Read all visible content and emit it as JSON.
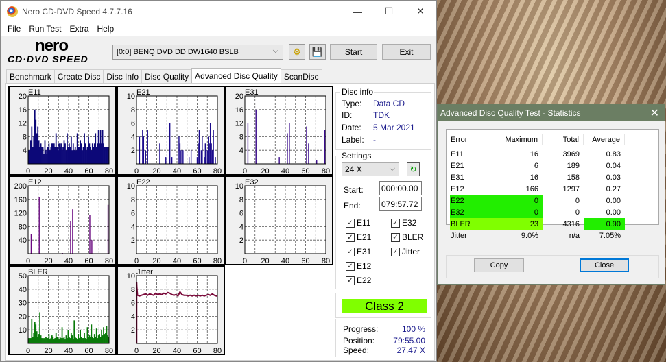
{
  "window": {
    "title": "Nero CD-DVD Speed 4.7.7.16",
    "controls": {
      "minimize": "—",
      "maximize": "☐",
      "close": "✕"
    }
  },
  "menu": [
    "File",
    "Run Test",
    "Extra",
    "Help"
  ],
  "logo": {
    "brand": "nero",
    "product": "CD·DVD SPEED"
  },
  "toolbar": {
    "drive": "[0:0]  BENQ DVD DD DW1640 BSLB",
    "start_label": "Start",
    "exit_label": "Exit"
  },
  "tabs": [
    {
      "label": "Benchmark",
      "active": false
    },
    {
      "label": "Create Disc",
      "active": false
    },
    {
      "label": "Disc Info",
      "active": false
    },
    {
      "label": "Disc Quality",
      "active": false
    },
    {
      "label": "Advanced Disc Quality",
      "active": true
    },
    {
      "label": "ScanDisc",
      "active": false
    }
  ],
  "disc_info": {
    "title": "Disc info",
    "rows": [
      {
        "key": "Type:",
        "value": "Data CD"
      },
      {
        "key": "ID:",
        "value": "TDK"
      },
      {
        "key": "Date:",
        "value": "5 Mar 2021"
      },
      {
        "key": "Label:",
        "value": "-"
      }
    ]
  },
  "settings": {
    "title": "Settings",
    "speed": "24 X",
    "start_label": "Start:",
    "start_value": "000:00.00",
    "end_label": "End:",
    "end_value": "079:57.72",
    "checks": [
      {
        "label": "E11",
        "checked": true
      },
      {
        "label": "E21",
        "checked": true
      },
      {
        "label": "E31",
        "checked": true
      },
      {
        "label": "E12",
        "checked": true
      },
      {
        "label": "E22",
        "checked": true
      },
      {
        "label": "E32",
        "checked": true
      },
      {
        "label": "BLER",
        "checked": true
      },
      {
        "label": "Jitter",
        "checked": true
      }
    ]
  },
  "class_badge": {
    "label": "Class 2",
    "color": "#80ff00"
  },
  "progress": {
    "rows": [
      {
        "key": "Progress:",
        "value": "100 %"
      },
      {
        "key": "Position:",
        "value": "79:55.00"
      },
      {
        "key": "Speed:",
        "value": "27.47 X"
      }
    ]
  },
  "stats_dialog": {
    "title": "Advanced Disc Quality Test - Statistics",
    "headers": [
      "Error",
      "Maximum",
      "Total",
      "Average"
    ],
    "rows": [
      {
        "error": "E11",
        "max": "16",
        "total": "3969",
        "avg": "0.83",
        "hl_err": "",
        "hl_avg": ""
      },
      {
        "error": "E21",
        "max": "6",
        "total": "189",
        "avg": "0.04",
        "hl_err": "",
        "hl_avg": ""
      },
      {
        "error": "E31",
        "max": "16",
        "total": "158",
        "avg": "0.03",
        "hl_err": "",
        "hl_avg": ""
      },
      {
        "error": "E12",
        "max": "166",
        "total": "1297",
        "avg": "0.27",
        "hl_err": "",
        "hl_avg": ""
      },
      {
        "error": "E22",
        "max": "0",
        "total": "0",
        "avg": "0.00",
        "hl_err": "#22ee00",
        "hl_avg": ""
      },
      {
        "error": "E32",
        "max": "0",
        "total": "0",
        "avg": "0.00",
        "hl_err": "#22ee00",
        "hl_avg": ""
      },
      {
        "error": "BLER",
        "max": "23",
        "total": "4316",
        "avg": "0.90",
        "hl_err": "#80ff00",
        "hl_avg": "#22ee00"
      },
      {
        "error": "Jitter",
        "max": "9.0%",
        "total": "n/a",
        "avg": "7.05%",
        "hl_err": "",
        "hl_avg": ""
      }
    ],
    "copy_label": "Copy",
    "close_label": "Close"
  },
  "chart_data": [
    {
      "type": "bar",
      "title": "E11",
      "color": "#0c0878",
      "xlim": [
        0,
        80
      ],
      "ylim": [
        0,
        20
      ],
      "yticks": [
        4,
        8,
        12,
        16,
        20
      ],
      "xticks": [
        0,
        20,
        40,
        60,
        80
      ],
      "x": [
        0,
        1,
        2,
        3,
        4,
        5,
        6,
        7,
        8,
        9,
        10,
        11,
        12,
        13,
        14,
        15,
        16,
        17,
        18,
        19,
        20,
        21,
        22,
        23,
        24,
        25,
        26,
        27,
        28,
        29,
        30,
        31,
        32,
        33,
        34,
        35,
        36,
        37,
        38,
        39,
        40,
        41,
        42,
        43,
        44,
        45,
        46,
        47,
        48,
        49,
        50,
        51,
        52,
        53,
        54,
        55,
        56,
        57,
        58,
        59,
        60,
        61,
        62,
        63,
        64,
        65,
        66,
        67,
        68,
        69,
        70,
        71,
        72,
        73,
        74,
        75,
        76,
        77,
        78,
        79
      ],
      "values": [
        4,
        4,
        7,
        11,
        5,
        8,
        16,
        13,
        9,
        11,
        7,
        5,
        6,
        5,
        5,
        3,
        7,
        4,
        3,
        5,
        6,
        4,
        5,
        6,
        6,
        6,
        5,
        9,
        5,
        4,
        6,
        5,
        6,
        4,
        5,
        7,
        6,
        4,
        9,
        5,
        6,
        5,
        8,
        4,
        6,
        4,
        5,
        4,
        9,
        5,
        5,
        7,
        6,
        4,
        5,
        9,
        6,
        4,
        5,
        8,
        6,
        5,
        4,
        6,
        5,
        6,
        9,
        5,
        6,
        10,
        6,
        10,
        6,
        10,
        6,
        5,
        5,
        5,
        5,
        5
      ]
    },
    {
      "type": "bar",
      "title": "E21",
      "color": "#1a0a8c",
      "xlim": [
        0,
        80
      ],
      "ylim": [
        0,
        10
      ],
      "yticks": [
        2,
        4,
        6,
        8,
        10
      ],
      "xticks": [
        0,
        20,
        40,
        60,
        80
      ],
      "x": [
        3,
        6,
        7,
        9,
        11,
        23,
        29,
        33,
        35,
        42,
        43,
        44,
        46,
        52,
        54,
        60,
        61,
        62,
        64,
        65,
        67,
        68,
        70,
        71,
        72,
        73,
        74,
        75,
        76,
        78
      ],
      "values": [
        4,
        5,
        4,
        2,
        5,
        3,
        1,
        6,
        1,
        4,
        3,
        2,
        2,
        1,
        2,
        1,
        3,
        5,
        2,
        4,
        1,
        3,
        2,
        4,
        3,
        6,
        3,
        2,
        5,
        1
      ]
    },
    {
      "type": "bar",
      "title": "E31",
      "color": "#3a0a8c",
      "xlim": [
        0,
        80
      ],
      "ylim": [
        0,
        20
      ],
      "yticks": [
        4,
        8,
        12,
        16,
        20
      ],
      "xticks": [
        0,
        20,
        40,
        60,
        80
      ],
      "x": [
        3,
        11,
        34,
        42,
        44,
        61,
        63,
        71,
        79
      ],
      "values": [
        12,
        16,
        2,
        9,
        12,
        11,
        6,
        1,
        10
      ]
    },
    {
      "type": "bar",
      "title": "E12",
      "color": "#6a0a80",
      "xlim": [
        0,
        80
      ],
      "ylim": [
        0,
        200
      ],
      "yticks": [
        40,
        80,
        120,
        160,
        200
      ],
      "xticks": [
        0,
        20,
        40,
        60,
        80
      ],
      "x": [
        3,
        11,
        34,
        42,
        44,
        61,
        63,
        79
      ],
      "values": [
        57,
        166,
        2,
        97,
        131,
        115,
        40,
        144
      ]
    },
    {
      "type": "bar",
      "title": "E22",
      "color": "#0c0878",
      "xlim": [
        0,
        80
      ],
      "ylim": [
        0,
        10
      ],
      "yticks": [
        2,
        4,
        6,
        8,
        10
      ],
      "xticks": [
        0,
        20,
        40,
        60,
        80
      ],
      "x": [],
      "values": []
    },
    {
      "type": "bar",
      "title": "E32",
      "color": "#0c0878",
      "xlim": [
        0,
        80
      ],
      "ylim": [
        0,
        10
      ],
      "yticks": [
        2,
        4,
        6,
        8,
        10
      ],
      "xticks": [
        0,
        20,
        40,
        60,
        80
      ],
      "x": [],
      "values": []
    },
    {
      "type": "bar",
      "title": "BLER",
      "color": "#0a7a0a",
      "xlim": [
        0,
        80
      ],
      "ylim": [
        0,
        50
      ],
      "yticks": [
        10,
        20,
        30,
        40,
        50
      ],
      "xticks": [
        0,
        20,
        40,
        60,
        80
      ],
      "x": [
        0,
        1,
        2,
        3,
        4,
        5,
        6,
        7,
        8,
        9,
        10,
        11,
        12,
        13,
        14,
        15,
        16,
        17,
        18,
        19,
        20,
        21,
        22,
        23,
        24,
        25,
        26,
        27,
        28,
        29,
        30,
        31,
        32,
        33,
        34,
        35,
        36,
        37,
        38,
        39,
        40,
        41,
        42,
        43,
        44,
        45,
        46,
        47,
        48,
        49,
        50,
        51,
        52,
        53,
        54,
        55,
        56,
        57,
        58,
        59,
        60,
        61,
        62,
        63,
        64,
        65,
        66,
        67,
        68,
        69,
        70,
        71,
        72,
        73,
        74,
        75,
        76,
        77,
        78,
        79
      ],
      "values": [
        4,
        4,
        4,
        18,
        5,
        8,
        16,
        14,
        9,
        5,
        7,
        23,
        6,
        4,
        3,
        4,
        3,
        5,
        4,
        4,
        7,
        3,
        4,
        6,
        5,
        3,
        4,
        8,
        5,
        4,
        3,
        5,
        4,
        12,
        4,
        5,
        3,
        6,
        4,
        10,
        5,
        4,
        8,
        6,
        3,
        17,
        5,
        4,
        3,
        7,
        4,
        10,
        5,
        4,
        4,
        8,
        4,
        3,
        12,
        5,
        6,
        5,
        14,
        5,
        4,
        7,
        5,
        11,
        4,
        6,
        7,
        5,
        10,
        6,
        12,
        7,
        8,
        13,
        6,
        5
      ]
    },
    {
      "type": "line",
      "title": "Jitter",
      "color": "#7a0a3a",
      "xlim": [
        0,
        80
      ],
      "ylim": [
        0,
        10
      ],
      "yticks": [
        2,
        4,
        6,
        8,
        10
      ],
      "xticks": [
        0,
        20,
        40,
        60,
        80
      ],
      "x": [
        0,
        1,
        3,
        5,
        7,
        9,
        11,
        13,
        15,
        17,
        19,
        21,
        23,
        25,
        27,
        29,
        31,
        33,
        35,
        37,
        39,
        41,
        43,
        45,
        47,
        49,
        51,
        53,
        55,
        57,
        59,
        61,
        63,
        65,
        67,
        69,
        71,
        73,
        75,
        77,
        79,
        80
      ],
      "values": [
        9.0,
        7.1,
        7.0,
        7.1,
        7.2,
        7.3,
        7.1,
        7.3,
        7.2,
        7.1,
        7.4,
        7.2,
        7.3,
        7.2,
        7.4,
        7.3,
        7.5,
        7.4,
        7.2,
        7.1,
        7.2,
        7.0,
        7.6,
        7.2,
        7.1,
        7.1,
        7.0,
        7.1,
        7.0,
        7.1,
        7.0,
        7.1,
        7.0,
        7.1,
        7.0,
        7.1,
        7.2,
        7.1,
        7.3,
        7.1,
        7.0,
        7.0
      ]
    }
  ]
}
